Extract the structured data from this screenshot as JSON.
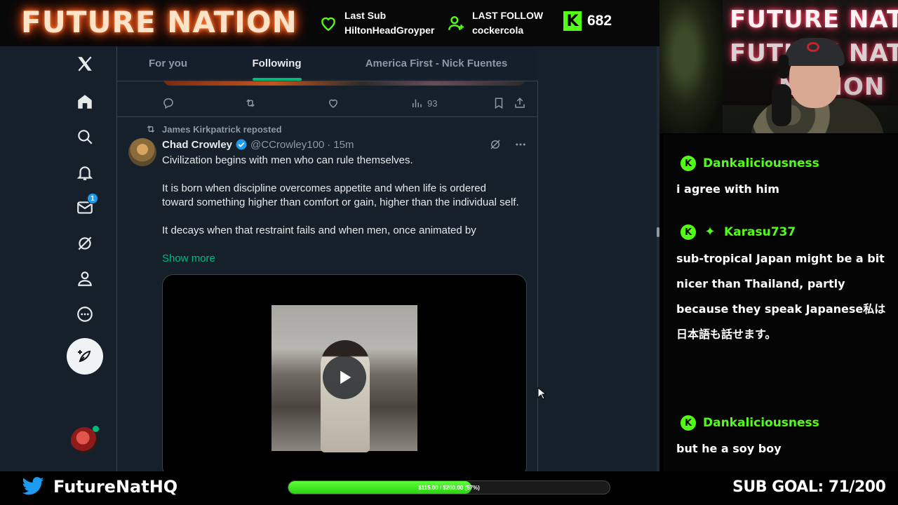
{
  "overlay": {
    "logo_text": "FUTURE NATION",
    "last_sub": {
      "label": "Last Sub",
      "value": "HiltonHeadGroyper"
    },
    "last_follow": {
      "label": "LAST FOLLOW",
      "value": "cockercola"
    },
    "kick": {
      "logo": "K",
      "viewer_count": "682"
    },
    "accent_color": "#53fc18"
  },
  "x_app": {
    "nav": [
      {
        "icon": "x-logo-icon"
      },
      {
        "icon": "home-icon"
      },
      {
        "icon": "search-icon"
      },
      {
        "icon": "notifications-icon"
      },
      {
        "icon": "messages-icon",
        "badge": "1"
      },
      {
        "icon": "grok-icon"
      },
      {
        "icon": "profile-icon"
      },
      {
        "icon": "more-icon"
      },
      {
        "icon": "compose-post-icon"
      }
    ],
    "tabs": [
      "For you",
      "Following",
      "America First - Nick Fuentes"
    ],
    "active_tab": "Following",
    "prev_tweet_actions": {
      "views": "93"
    },
    "tweet": {
      "repost_by": "James Kirkpatrick reposted",
      "name": "Chad Crowley",
      "handle": "@CCrowley100",
      "dot": "·",
      "time": "15m",
      "paragraphs": [
        "Civilization begins with men who can rule themselves.",
        "It is born when discipline overcomes appetite and when life is ordered toward something higher than comfort or gain, higher than the individual self.",
        "It decays when that restraint fails and when men, once animated by"
      ],
      "show_more": "Show more"
    }
  },
  "webcam": {
    "neon_lines": [
      "FUTURE NATION",
      "FUTURE NATION",
      "NATION"
    ]
  },
  "chat": [
    {
      "user": "Dankaliciousness",
      "message": "i agree with him"
    },
    {
      "user": "Karasu737",
      "message": "sub-tropical Japan might be a bit nicer than Thailand, partly because they speak Japanese私は日本語も話せます。"
    },
    {
      "user": "Dankaliciousness",
      "message": "but he a soy boy"
    }
  ],
  "bottom": {
    "twitter_handle": "FutureNatHQ",
    "goal_text": "$115.00 / $200.00 (57%)",
    "goal_progress": 0.57,
    "sub_goal": "SUB GOAL: 71/200"
  }
}
